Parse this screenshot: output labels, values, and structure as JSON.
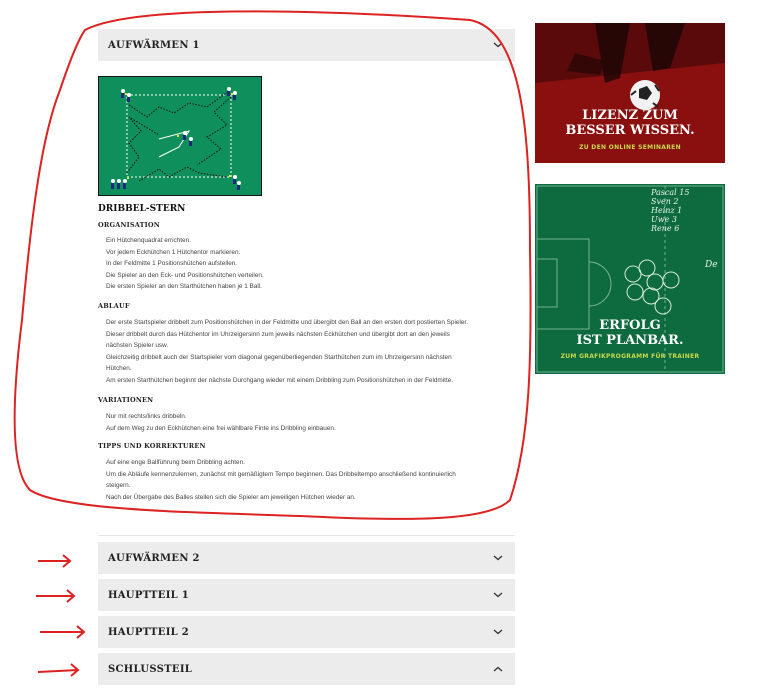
{
  "accordion": {
    "open": {
      "title": "AUFWÄRMEN 1"
    },
    "items": [
      {
        "title": "AUFWÄRMEN 2"
      },
      {
        "title": "HAUPTTEIL 1"
      },
      {
        "title": "HAUPTTEIL 2"
      },
      {
        "title": "SCHLUSSTEIL"
      }
    ]
  },
  "drill": {
    "name": "DRIBBEL-STERN",
    "organisation": {
      "heading": "ORGANISATION",
      "lines": [
        "Ein Hütchenquadrat errichten.",
        "Vor jedem Eckhütchen 1 Hütchentor markieren.",
        "In der Feldmitte 1 Positionshütchen aufstellen.",
        "Die Spieler an den Eck- und Positionshütchen verteilen.",
        "Die ersten Spieler an den Starthütchen haben je 1 Ball."
      ]
    },
    "ablauf": {
      "heading": "ABLAUF",
      "lines": [
        "Der erste Startspieler dribbelt zum Positionshütchen in der Feldmitte und übergibt den Ball an den ersten dort postierten Spieler.",
        "Dieser dribbelt durch das Hütchentor im Uhrzeigersinn zum jeweils nächsten Eckhütchen und übergibt dort an den jeweils",
        "nächsten Spieler usw.",
        "Gleichzeitig dribbelt auch der Startspieler vom diagonal gegenüberliegenden Starthütchen zum im Uhrzeigersinn nächsten",
        "Hütchen.",
        "Am ersten Starthütchen beginnt der nächste Durchgang wieder mit einem Dribbling zum Positionshütchen in der Feldmitte."
      ]
    },
    "variationen": {
      "heading": "VARIATIONEN",
      "lines": [
        "Nur mit rechts/links dribbeln.",
        "Auf dem Weg zu den Eckhütchen eine frei wählbare Finte ins Dribbling einbauen."
      ]
    },
    "tipps": {
      "heading": "TIPPS UND KORREKTUREN",
      "lines": [
        "Auf eine enge Ballführung beim Dribbling achten.",
        "Um die Abläufe kennenzulernen, zunächst mit gemäßigtem Tempo beginnen. Das Dribbeltempo anschließend kontinuierlich",
        "steigern.",
        "Nach der Übergabe des Balles stellen sich die Spieler am jeweiligen Hütchen wieder an."
      ]
    }
  },
  "ads": {
    "ad1": {
      "line1": "LIZENZ ZUM",
      "line2": "BESSER WISSEN.",
      "sub": "ZU DEN ONLINE SEMINAREN"
    },
    "ad2": {
      "line1": "ERFOLG",
      "line2": "IST PLANBAR.",
      "sub": "ZUM GRAFIKPROGRAMM FÜR TRAINER",
      "board_notes": [
        "Pascal 15",
        "Sven 2",
        "Heinz 1",
        "Uwe 3",
        "Rene 6"
      ],
      "board_side": "De"
    }
  },
  "colors": {
    "accordion_bg": "#ececec",
    "pitch": "#0f8f5c",
    "annotation": "#dd2222",
    "ad_accent": "#c7d94a"
  },
  "icons": {
    "chevron_down": "chevron-down-icon",
    "chevron_up": "chevron-up-icon",
    "arrow": "arrow-right-icon"
  }
}
